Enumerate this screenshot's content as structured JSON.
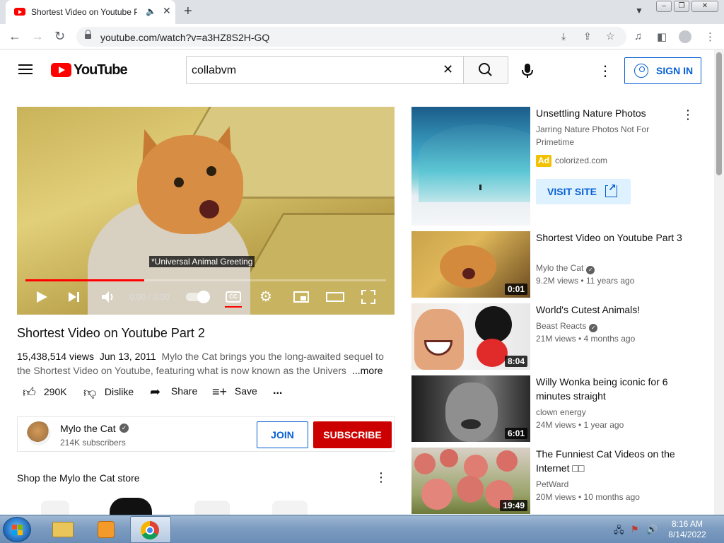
{
  "browser": {
    "tab_title": "Shortest Video on Youtube P",
    "tab_close": "✕",
    "new_tab": "+",
    "url": "youtube.com/watch?v=a3HZ8S2H-GQ"
  },
  "header": {
    "logo_text": "YouTube",
    "search": {
      "value": "collabvm",
      "clear": "✕"
    },
    "sign_in_label": "SIGN IN"
  },
  "player": {
    "caption": "*Universal Animal Greeting",
    "time": "0:00 / 0:00",
    "progress_fraction": 0.33,
    "cc_label": "CC"
  },
  "video": {
    "title": "Shortest Video on Youtube Part 2",
    "views": "15,438,514 views",
    "date": "Jun 13, 2011",
    "description_line1": "Mylo the Cat brings you the long-awaited sequel to",
    "description_line2": "the Shortest Video on Youtube, featuring what is now known as the Univers",
    "more_label": "...more",
    "actions": {
      "likes": "290K",
      "dislike": "Dislike",
      "share": "Share",
      "save": "Save",
      "more": "..."
    }
  },
  "channel": {
    "name": "Mylo the Cat",
    "subscribers": "214K subscribers",
    "join_label": "JOIN",
    "subscribe_label": "SUBSCRIBE"
  },
  "shop": {
    "title": "Shop the Mylo the Cat store"
  },
  "sidebar": {
    "ad": {
      "title": "Unsettling Nature Photos",
      "subtitle": "Jarring Nature Photos Not For Primetime",
      "badge": "Ad",
      "domain": "colorized.com",
      "cta": "VISIT SITE"
    },
    "videos": [
      {
        "title": "Shortest Video on Youtube Part 3",
        "channel": "Mylo the Cat",
        "verified": true,
        "meta": "9.2M views • 11 years ago",
        "duration": "0:01"
      },
      {
        "title": "World's Cutest Animals!",
        "channel": "Beast Reacts",
        "verified": true,
        "meta": "21M views • 4 months ago",
        "duration": "8:04"
      },
      {
        "title": "Willy Wonka being iconic for 6 minutes straight",
        "channel": "clown energy",
        "verified": false,
        "meta": "24M views • 1 year ago",
        "duration": "6:01"
      },
      {
        "title": "The Funniest Cat Videos on the Internet □□",
        "channel": "PetWard",
        "verified": false,
        "meta": "20M views • 10 months ago",
        "duration": "19:49"
      }
    ]
  },
  "taskbar": {
    "time": "8:16 AM",
    "date": "8/14/2022"
  },
  "colors": {
    "youtube_red": "#ff0000",
    "subscribe_red": "#cc0000",
    "link_blue": "#065fd4"
  }
}
